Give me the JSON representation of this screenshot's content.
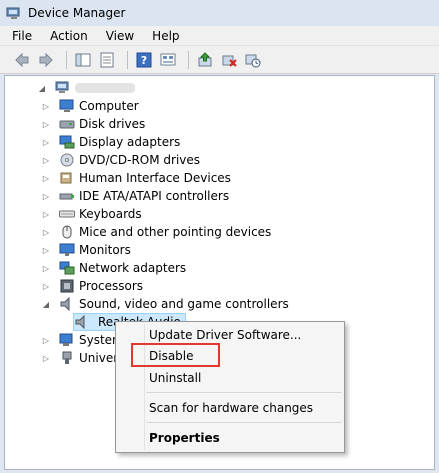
{
  "window": {
    "title": "Device Manager"
  },
  "menubar": {
    "items": [
      "File",
      "Action",
      "View",
      "Help"
    ]
  },
  "toolbar": {
    "buttons": [
      "back-arrow-icon",
      "forward-arrow-icon",
      "show-hide-tree-icon",
      "properties-icon",
      "help-icon",
      "device-view-icon",
      "update-driver-icon",
      "uninstall-icon",
      "scan-hardware-icon"
    ]
  },
  "tree": {
    "root": {
      "label": ""
    },
    "items": [
      {
        "label": "Computer",
        "icon": "computer-icon",
        "expanded": false
      },
      {
        "label": "Disk drives",
        "icon": "disk-drive-icon",
        "expanded": false
      },
      {
        "label": "Display adapters",
        "icon": "display-adapter-icon",
        "expanded": false
      },
      {
        "label": "DVD/CD-ROM drives",
        "icon": "dvd-drive-icon",
        "expanded": false
      },
      {
        "label": "Human Interface Devices",
        "icon": "hid-icon",
        "expanded": false
      },
      {
        "label": "IDE ATA/ATAPI controllers",
        "icon": "ide-controller-icon",
        "expanded": false
      },
      {
        "label": "Keyboards",
        "icon": "keyboard-icon",
        "expanded": false
      },
      {
        "label": "Mice and other pointing devices",
        "icon": "mouse-icon",
        "expanded": false
      },
      {
        "label": "Monitors",
        "icon": "monitor-icon",
        "expanded": false
      },
      {
        "label": "Network adapters",
        "icon": "network-adapter-icon",
        "expanded": false
      },
      {
        "label": "Processors",
        "icon": "processor-icon",
        "expanded": false
      },
      {
        "label": "Sound, video and game controllers",
        "icon": "speaker-icon",
        "expanded": true
      },
      {
        "label": "Realtek Audio",
        "icon": "speaker-icon",
        "child": true,
        "selected": true
      },
      {
        "label": "System",
        "icon": "system-device-icon",
        "expanded": false
      },
      {
        "label": "Univers",
        "icon": "usb-controller-icon",
        "expanded": false
      }
    ]
  },
  "context_menu": {
    "items": [
      {
        "label": "Update Driver Software...",
        "bold": false
      },
      {
        "label": "Disable",
        "bold": false,
        "highlighted": true
      },
      {
        "label": "Uninstall",
        "bold": false
      },
      {
        "label": "Scan for hardware changes",
        "bold": false
      },
      {
        "label": "Properties",
        "bold": true
      }
    ]
  },
  "colors": {
    "highlight_border": "#e03a30",
    "selection": "#cce8ff"
  }
}
